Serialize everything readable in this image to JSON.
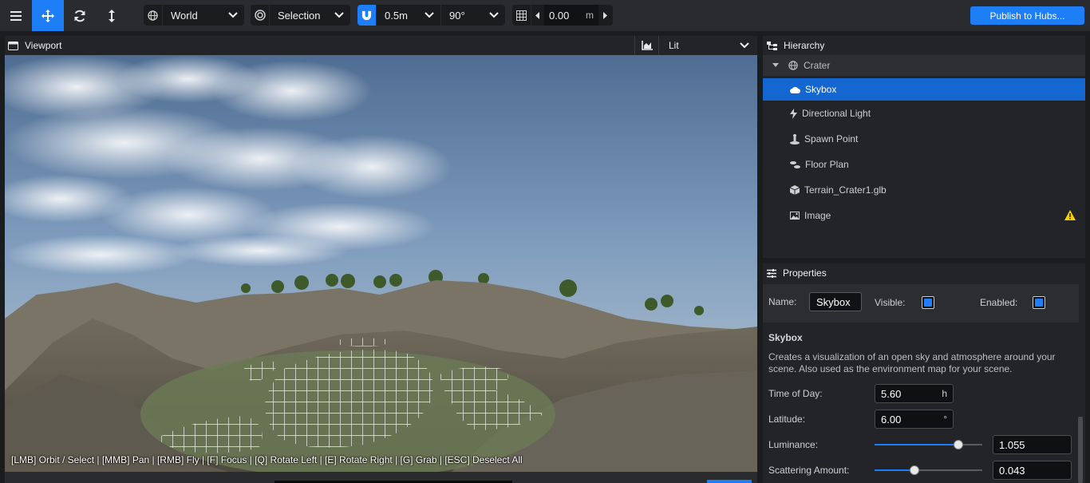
{
  "toolbar": {
    "space_mode": "World",
    "transform_pivot": "Selection",
    "snap_translate": "0.5m",
    "snap_rotate": "90°",
    "grid_height": "0.00",
    "grid_unit": "m",
    "publish_label": "Publish to Hubs..."
  },
  "viewport": {
    "title": "Viewport",
    "render_mode": "Lit",
    "controls_hint": "[LMB] Orbit / Select | [MMB] Pan | [RMB] Fly | [F] Focus | [Q] Rotate Left | [E] Rotate Right | [G] Grab | [ESC] Deselect All"
  },
  "hierarchy": {
    "title": "Hierarchy",
    "root": "Crater",
    "items": [
      {
        "label": "Skybox",
        "icon": "cloud-icon",
        "selected": true
      },
      {
        "label": "Directional Light",
        "icon": "bolt-icon"
      },
      {
        "label": "Spawn Point",
        "icon": "spawn-point-icon"
      },
      {
        "label": "Floor Plan",
        "icon": "shoe-prints-icon"
      },
      {
        "label": "Terrain_Crater1.glb",
        "icon": "cube-icon"
      },
      {
        "label": "Image",
        "icon": "image-icon",
        "warning": true
      }
    ]
  },
  "properties": {
    "title": "Properties",
    "name_label": "Name:",
    "name_value": "Skybox",
    "visible_label": "Visible:",
    "visible": true,
    "enabled_label": "Enabled:",
    "enabled": true,
    "section_title": "Skybox",
    "description": "Creates a visualization of an open sky and atmosphere around your scene. Also used as the environment map for your scene.",
    "time_of_day_label": "Time of Day:",
    "time_of_day": "5.60",
    "time_of_day_unit": "h",
    "latitude_label": "Latitude:",
    "latitude": "6.00",
    "latitude_unit": "°",
    "luminance_label": "Luminance:",
    "luminance": "1.055",
    "luminance_slider_fraction": 0.78,
    "scattering_label": "Scattering Amount:",
    "scattering": "0.043",
    "scattering_slider_fraction": 0.37
  },
  "colors": {
    "accent": "#1e7ef7",
    "selected_row": "#1466d1",
    "panel": "#232427",
    "background": "#1b1c1e",
    "warning": "#f5d000"
  }
}
